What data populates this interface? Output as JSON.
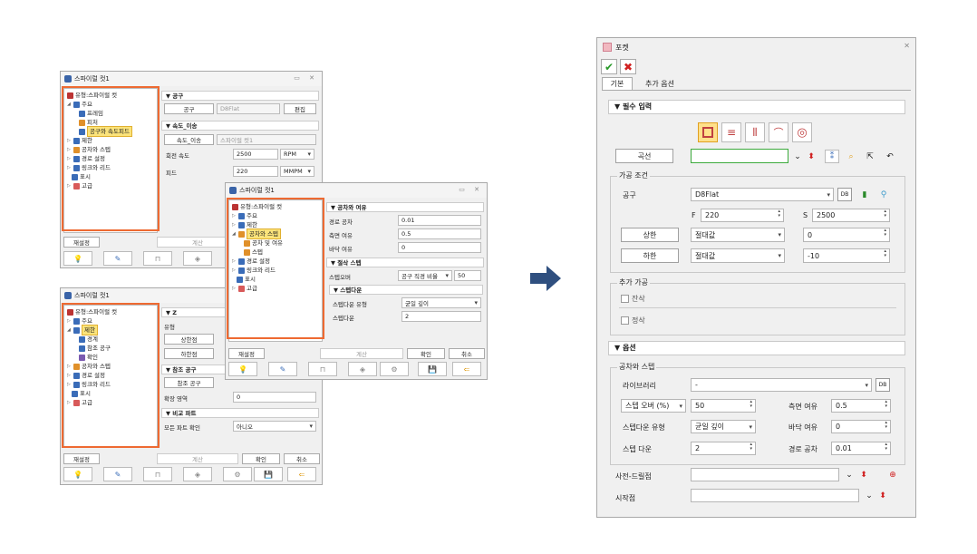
{
  "win1": {
    "title": "스파이럴 컷1",
    "tree": [
      "유형:스파이럴 컷",
      "주요",
      "프레임",
      "피처",
      "공구와 속도피드",
      "제한",
      "공차와 스텝",
      "경로 설정",
      "링크와 리드",
      "표시",
      "고급"
    ],
    "sec_tool": "▼ 공구",
    "tool_btn": "공구",
    "tool_value": "D8Flat",
    "edit_btn": "편집",
    "sec_speed": "▼ 속도_이송",
    "speed_btn": "속도_이송",
    "speed_value": "스파이럴 컷1",
    "spindle_lbl": "회전 속도",
    "spindle_val": "2500",
    "spindle_unit": "RPM",
    "feed_lbl": "피드",
    "feed_val": "220",
    "feed_unit": "MMPM",
    "reset": "재설정",
    "calc": "계산"
  },
  "win2": {
    "title": "스파이럴 컷1",
    "tree": [
      "유형:스파이럴 컷",
      "주요",
      "제한",
      "공차와 스텝",
      "공차 및 여유",
      "스텝",
      "경로 설정",
      "링크와 리드",
      "표시",
      "고급"
    ],
    "sec_tol": "▼ 공차와 여유",
    "tol_lbl": "경로 공차",
    "tol_val": "0.01",
    "side_lbl": "측면 여유",
    "side_val": "0.5",
    "floor_lbl": "바닥 여유",
    "floor_val": "0",
    "sec_step": "▼ 절삭 스텝",
    "stepover_lbl": "스텝오버",
    "stepover_mode": "공구 직경 비율",
    "stepover_val": "50",
    "sec_stepdown": "▼ 스텝다운",
    "sd_type_lbl": "스텝다운 유형",
    "sd_type_val": "균일 깊이",
    "sd_lbl": "스텝다운",
    "sd_val": "2",
    "reset": "재설정",
    "calc": "계산",
    "ok": "확인",
    "cancel": "취소"
  },
  "win3": {
    "title": "스파이럴 컷1",
    "tree": [
      "유형:스파이럴 컷",
      "주요",
      "제한",
      "경계",
      "참조 공구",
      "확인",
      "공차와 스텝",
      "경로 설정",
      "링크와 리드",
      "표시",
      "고급"
    ],
    "sec_z": "▼ Z",
    "type_lbl": "유형",
    "top_btn": "상한점",
    "bottom_btn": "하한점",
    "sec_ref": "▼ 참조 공구",
    "ref_btn": "참조 공구",
    "area_lbl": "확장 영역",
    "area_val": "0",
    "sec_cmp": "▼ 비교 파트",
    "cmp_lbl": "모든 파트 확인",
    "cmp_val": "아니오",
    "reset": "재설정",
    "calc": "계산",
    "ok": "확인",
    "cancel": "취소"
  },
  "pocket": {
    "title": "포켓",
    "tabs": [
      "기본",
      "추가 옵션"
    ],
    "sec_required": "▼ 필수 입력",
    "curve_btn": "곡선",
    "grp_cut": "가공 조건",
    "tool_lbl": "공구",
    "tool_val": "D8Flat",
    "f_lbl": "F",
    "f_val": "220",
    "s_lbl": "S",
    "s_val": "2500",
    "top_btn": "상한",
    "top_mode": "절대값",
    "top_val": "0",
    "bottom_btn": "하한",
    "bottom_mode": "절대값",
    "bottom_val": "-10",
    "grp_extra": "추가 가공",
    "rest_lbl": "잔삭",
    "finish_lbl": "정삭",
    "sec_options": "▼ 옵션",
    "grp_tol": "공차와 스텝",
    "lib_lbl": "라이브러리",
    "lib_val": "-",
    "stepover_mode": "스텝 오버 (%)",
    "stepover_val": "50",
    "side_lbl": "측면 여유",
    "side_val": "0.5",
    "sd_type_lbl": "스텝다운 유형",
    "sd_type_val": "균일 깊이",
    "floor_lbl": "바닥 여유",
    "floor_val": "0",
    "sd_lbl": "스텝 다운",
    "sd_val": "2",
    "tol_lbl": "경로 공차",
    "tol_val": "0.01",
    "predrill_lbl": "사전-드릴점",
    "start_lbl": "시작점"
  },
  "colors": {
    "highlight": "#ee6a32",
    "arrow": "#2f4f7f",
    "ok": "#2a9a2a",
    "cancel": "#d02020"
  }
}
